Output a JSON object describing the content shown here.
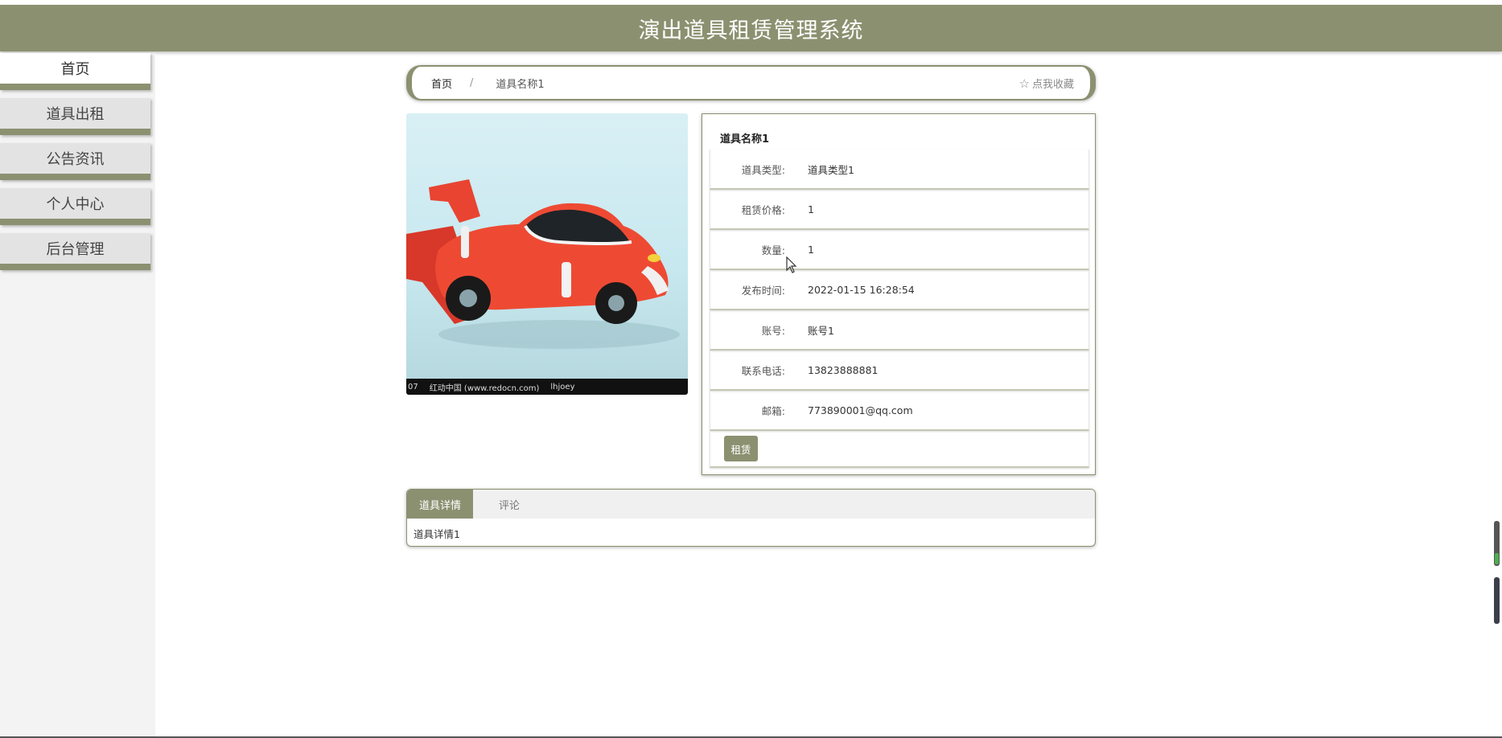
{
  "header": {
    "title": "演出道具租赁管理系统"
  },
  "sidebar": {
    "items": [
      {
        "label": "首页"
      },
      {
        "label": "道具出租"
      },
      {
        "label": "公告资讯"
      },
      {
        "label": "个人中心"
      },
      {
        "label": "后台管理"
      }
    ]
  },
  "breadcrumb": {
    "home": "首页",
    "separator": "/",
    "current": "道具名称1",
    "favorite": "点我收藏",
    "favorite_icon": "star-outline-icon"
  },
  "photo": {
    "caption_left": "07",
    "caption_mid": "红动中国 (www.redocn.com)",
    "caption_right": "lhjoey"
  },
  "detail": {
    "title": "道具名称1",
    "rows": [
      {
        "label": "道具类型:",
        "value": "道具类型1"
      },
      {
        "label": "租赁价格:",
        "value": "1"
      },
      {
        "label": "数量:",
        "value": "1"
      },
      {
        "label": "发布时间:",
        "value": "2022-01-15 16:28:54"
      },
      {
        "label": "账号:",
        "value": "账号1"
      },
      {
        "label": "联系电话:",
        "value": "13823888881"
      },
      {
        "label": "邮箱:",
        "value": "773890001@qq.com"
      }
    ],
    "rent_button": "租赁"
  },
  "tabs": {
    "items": [
      {
        "label": "道具详情"
      },
      {
        "label": "评论"
      }
    ],
    "content": "道具详情1"
  },
  "colors": {
    "accent": "#8b9170",
    "sidebar_bg": "#f3f3f3"
  }
}
